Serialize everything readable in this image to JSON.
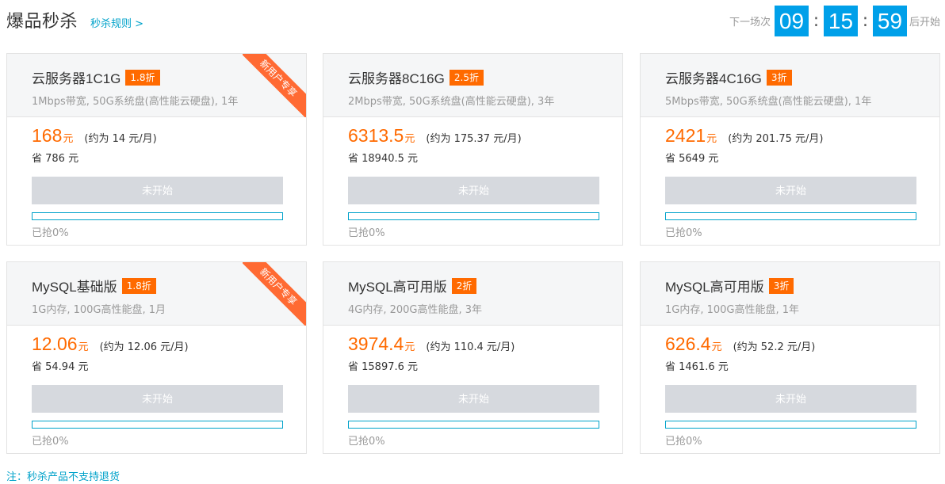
{
  "header": {
    "title": "爆品秒杀",
    "rules_link": "秒杀规则 >"
  },
  "countdown": {
    "prefix": "下一场次",
    "hours": "09",
    "minutes": "15",
    "seconds": "59",
    "separator": ":",
    "suffix": "后开始"
  },
  "cards": [
    {
      "name": "云服务器1C1G",
      "discount": "1.8折",
      "ribbon": "新用户专享",
      "spec": "1Mbps带宽, 50G系统盘(高性能云硬盘), 1年",
      "price": "168",
      "unit": "元",
      "monthly": "(约为 14 元/月)",
      "save": "省 786 元",
      "button": "未开始",
      "sold": "已抢0%",
      "progress": 0
    },
    {
      "name": "云服务器8C16G",
      "discount": "2.5折",
      "ribbon": "",
      "spec": "2Mbps带宽, 50G系统盘(高性能云硬盘), 3年",
      "price": "6313.5",
      "unit": "元",
      "monthly": "(约为 175.37 元/月)",
      "save": "省 18940.5 元",
      "button": "未开始",
      "sold": "已抢0%",
      "progress": 0
    },
    {
      "name": "云服务器4C16G",
      "discount": "3折",
      "ribbon": "",
      "spec": "5Mbps带宽, 50G系统盘(高性能云硬盘), 1年",
      "price": "2421",
      "unit": "元",
      "monthly": "(约为 201.75 元/月)",
      "save": "省 5649 元",
      "button": "未开始",
      "sold": "已抢0%",
      "progress": 0
    },
    {
      "name": "MySQL基础版",
      "discount": "1.8折",
      "ribbon": "新用户专享",
      "spec": "1G内存, 100G高性能盘, 1月",
      "price": "12.06",
      "unit": "元",
      "monthly": "(约为 12.06 元/月)",
      "save": "省 54.94 元",
      "button": "未开始",
      "sold": "已抢0%",
      "progress": 0
    },
    {
      "name": "MySQL高可用版",
      "discount": "2折",
      "ribbon": "",
      "spec": "4G内存, 200G高性能盘, 3年",
      "price": "3974.4",
      "unit": "元",
      "monthly": "(约为 110.4 元/月)",
      "save": "省 15897.6 元",
      "button": "未开始",
      "sold": "已抢0%",
      "progress": 0
    },
    {
      "name": "MySQL高可用版",
      "discount": "3折",
      "ribbon": "",
      "spec": "1G内存, 100G高性能盘, 1年",
      "price": "626.4",
      "unit": "元",
      "monthly": "(约为 52.2 元/月)",
      "save": "省 1461.6 元",
      "button": "未开始",
      "sold": "已抢0%",
      "progress": 0
    }
  ],
  "note": "注：秒杀产品不支持退货",
  "colors": {
    "accent": "#ff6a00",
    "link": "#00a2ca",
    "countdown_bg": "#00a0e9",
    "disabled_button": "#d6d9de"
  }
}
